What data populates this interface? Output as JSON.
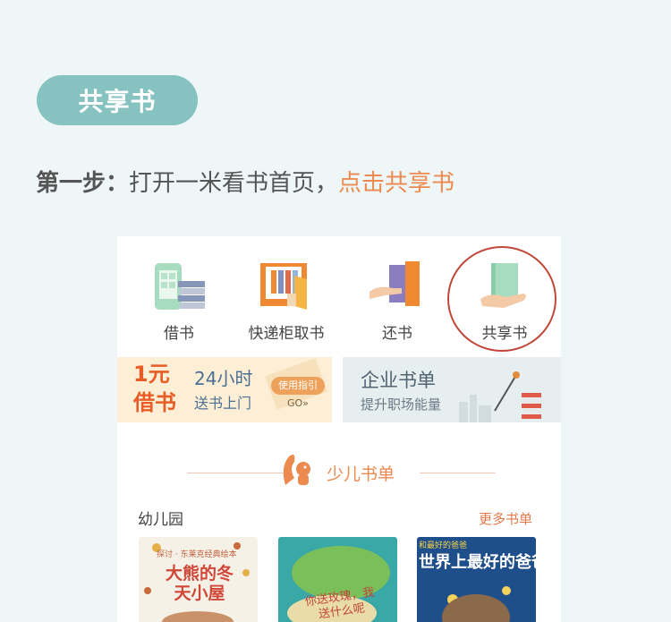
{
  "header": {
    "pill_label": "共享书",
    "step_prefix": "第一步：",
    "step_text": "打开一米看书首页，",
    "step_highlight": "点击共享书"
  },
  "app": {
    "icons": [
      {
        "label": "借书",
        "icon": "phone-books-icon"
      },
      {
        "label": "快递柜取书",
        "icon": "locker-icon"
      },
      {
        "label": "还书",
        "icon": "return-book-icon"
      },
      {
        "label": "共享书",
        "icon": "hand-book-icon"
      }
    ],
    "banner1": {
      "big1": "1元",
      "big2": "借书",
      "line1": "24小时",
      "line2": "送书上门",
      "button": "使用指引",
      "go": "GO»"
    },
    "banner2": {
      "title": "企业书单",
      "subtitle": "提升职场能量"
    },
    "section_title": "少儿书单",
    "category": "幼儿园",
    "more_link": "更多书单",
    "books": [
      {
        "title": "大熊的冬天小屋",
        "tag": "探讨 · 东莱克经典绘本"
      },
      {
        "title": "你送玫瑰，我送什么呢",
        "tag": ""
      },
      {
        "title": "世界上最好的爸爸",
        "tag": "和最好的爸爸"
      }
    ]
  },
  "colors": {
    "accent": "#86c2c0",
    "highlight": "#ec8a4f",
    "circle": "#c0483a"
  }
}
